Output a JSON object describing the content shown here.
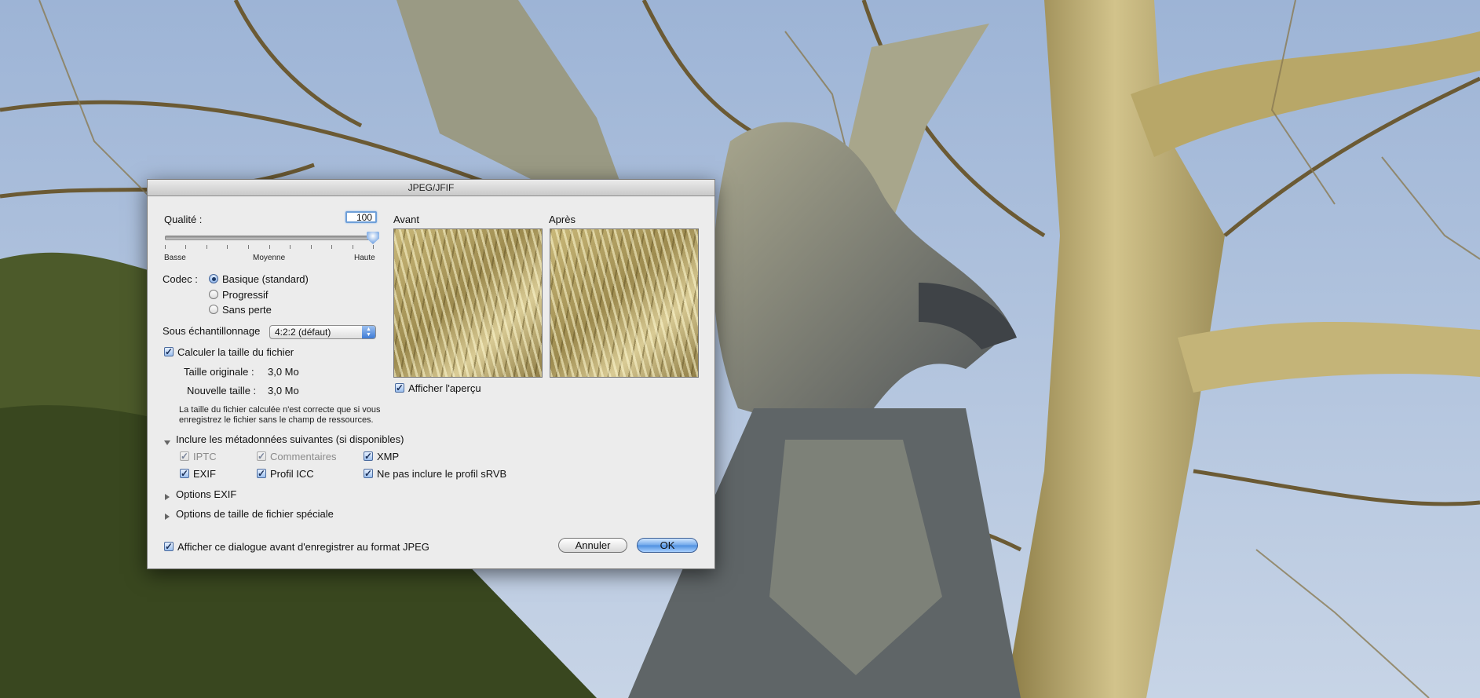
{
  "dialog": {
    "title": "JPEG/JFIF",
    "quality": {
      "label": "Qualité :",
      "value": "100",
      "slider_value": 100,
      "tick_low": "Basse",
      "tick_mid": "Moyenne",
      "tick_high": "Haute"
    },
    "codec": {
      "label": "Codec :",
      "options": [
        "Basique (standard)",
        "Progressif",
        "Sans perte"
      ],
      "selected": "Basique (standard)"
    },
    "subsampling": {
      "label": "Sous échantillonnage",
      "value": "4:2:2 (défaut)"
    },
    "calc_size": {
      "label": "Calculer la taille du fichier",
      "checked": true,
      "original_label": "Taille originale :",
      "original_value": "3,0 Mo",
      "new_label": "Nouvelle taille :",
      "new_value": "3,0 Mo",
      "note": "La taille du fichier calculée n'est correcte que si vous enregistrez le fichier sans le champ de ressources."
    },
    "preview": {
      "before_label": "Avant",
      "after_label": "Après",
      "show_preview_label": "Afficher l'aperçu",
      "show_preview_checked": true
    },
    "metadata": {
      "header": "Inclure les métadonnées suivantes (si disponibles)",
      "iptc": "IPTC",
      "comments": "Commentaires",
      "xmp": "XMP",
      "exif": "EXIF",
      "icc": "Profil ICC",
      "no_srgb": "Ne pas inclure le profil sRVB"
    },
    "exif_options": "Options EXIF",
    "size_options": "Options de taille de fichier spéciale",
    "show_dialog_label": "Afficher ce dialogue avant d'enregistrer au format JPEG",
    "cancel_label": "Annuler",
    "ok_label": "OK"
  }
}
